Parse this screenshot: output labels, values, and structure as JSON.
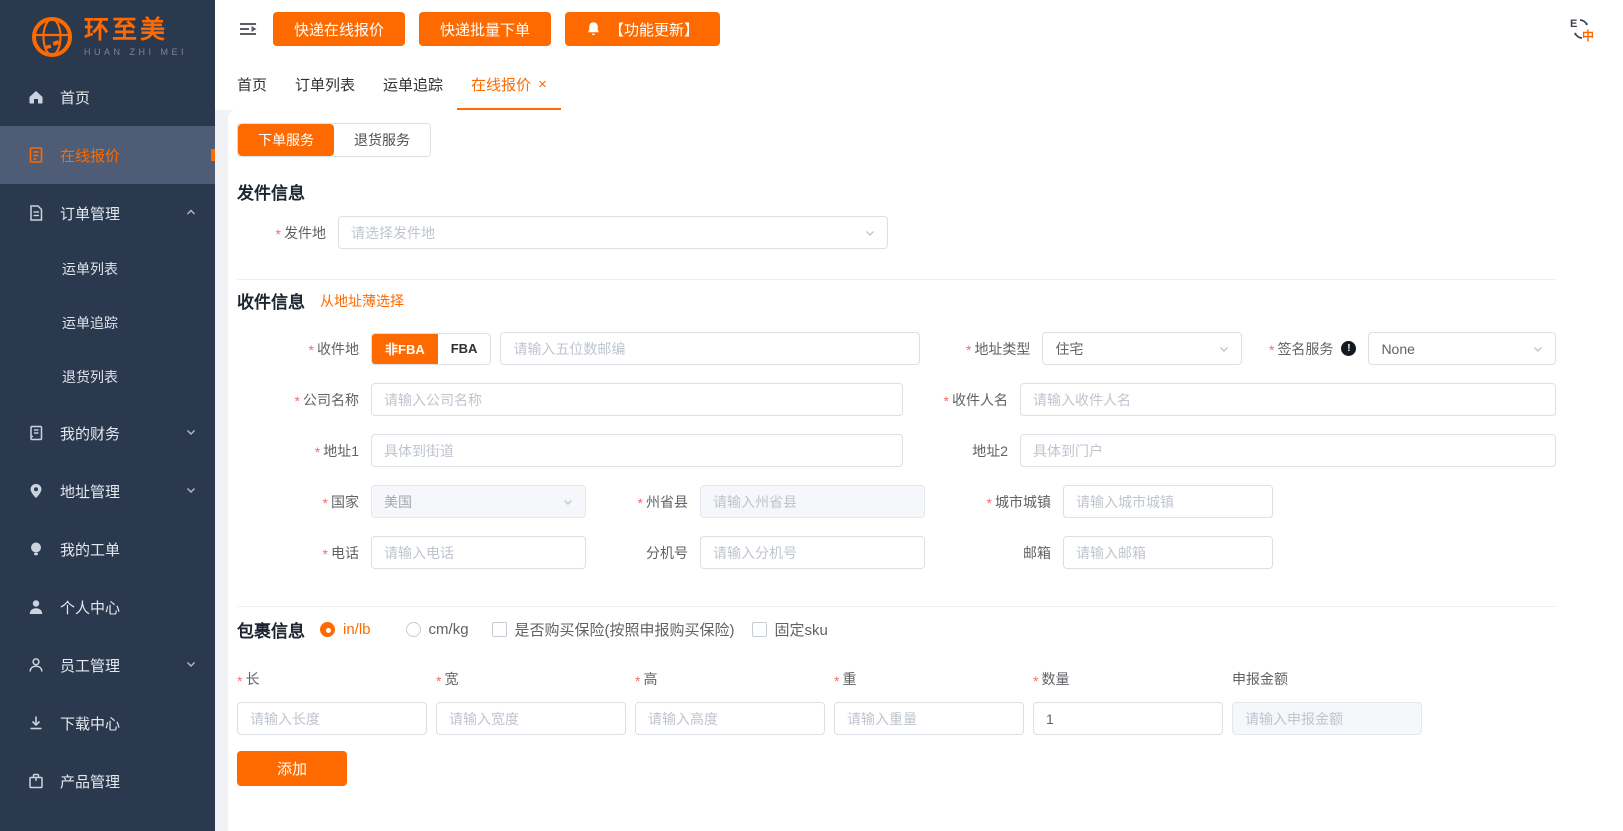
{
  "colors": {
    "accent": "#ff6a00",
    "sidebar_bg": "#2b394e",
    "sidebar_active_bg": "#4e5c75",
    "asterisk": "#f56c6c"
  },
  "misc": {
    "required_marker": "*"
  },
  "brand": {
    "name_cn": "环至美",
    "name_en": "HUAN ZHI MEI"
  },
  "sidebar": {
    "items": [
      {
        "label": "首页",
        "icon": "home-icon"
      },
      {
        "label": "在线报价",
        "icon": "quote-document-icon",
        "active": true
      },
      {
        "label": "订单管理",
        "icon": "order-document-icon",
        "expanded": true,
        "children": [
          {
            "label": "运单列表"
          },
          {
            "label": "运单追踪"
          },
          {
            "label": "退货列表"
          }
        ]
      },
      {
        "label": "我的财务",
        "icon": "finance-ledger-icon",
        "collapsed": true
      },
      {
        "label": "地址管理",
        "icon": "location-pin-icon",
        "collapsed": true
      },
      {
        "label": "我的工单",
        "icon": "work-order-bulb-icon"
      },
      {
        "label": "个人中心",
        "icon": "user-icon"
      },
      {
        "label": "员工管理",
        "icon": "staff-icon",
        "collapsed": true
      },
      {
        "label": "下载中心",
        "icon": "download-icon"
      },
      {
        "label": "产品管理",
        "icon": "product-box-icon"
      }
    ]
  },
  "topbar": {
    "buttons": [
      {
        "label": "快递在线报价"
      },
      {
        "label": "快递批量下单"
      },
      {
        "label": "【功能更新】",
        "icon": "bell-icon"
      }
    ],
    "lang_icon": {
      "from": "E",
      "to": "中"
    }
  },
  "tabs": {
    "items": [
      {
        "label": "首页"
      },
      {
        "label": "订单列表"
      },
      {
        "label": "运单追踪"
      },
      {
        "label": "在线报价",
        "active": true,
        "closable": true
      }
    ]
  },
  "service_tabs": {
    "items": [
      {
        "label": "下单服务",
        "active": true
      },
      {
        "label": "退货服务"
      }
    ]
  },
  "sender": {
    "title": "发件信息",
    "origin": {
      "label": "发件地",
      "required": true,
      "placeholder": "请选择发件地"
    }
  },
  "receiver": {
    "title": "收件信息",
    "address_book_link": "从地址薄选择",
    "fields": {
      "dest": {
        "label": "收件地",
        "required": true,
        "toggle": [
          {
            "label": "非FBA",
            "active": true
          },
          {
            "label": "FBA",
            "active": false
          }
        ],
        "zip_placeholder": "请输入五位数邮编"
      },
      "address_type": {
        "label": "地址类型",
        "required": true,
        "value": "住宅"
      },
      "signature": {
        "label": "签名服务",
        "required": true,
        "value": "None"
      },
      "company": {
        "label": "公司名称",
        "required": true,
        "placeholder": "请输入公司名称"
      },
      "recipient": {
        "label": "收件人名",
        "required": true,
        "placeholder": "请输入收件人名"
      },
      "address1": {
        "label": "地址1",
        "required": true,
        "placeholder": "具体到街道"
      },
      "address2": {
        "label": "地址2",
        "required": false,
        "placeholder": "具体到门户"
      },
      "country": {
        "label": "国家",
        "required": true,
        "value": "美国",
        "disabled": true
      },
      "state": {
        "label": "州省县",
        "required": true,
        "placeholder": "请输入州省县",
        "disabled": true
      },
      "city": {
        "label": "城市城镇",
        "required": true,
        "placeholder": "请输入城市城镇"
      },
      "phone": {
        "label": "电话",
        "required": true,
        "placeholder": "请输入电话"
      },
      "ext": {
        "label": "分机号",
        "required": false,
        "placeholder": "请输入分机号"
      },
      "email": {
        "label": "邮箱",
        "required": false,
        "placeholder": "请输入邮箱"
      }
    }
  },
  "package": {
    "title": "包裹信息",
    "units": [
      {
        "label": "in/lb",
        "selected": true
      },
      {
        "label": "cm/kg",
        "selected": false
      }
    ],
    "options": [
      {
        "label": "是否购买保险(按照申报购买保险)",
        "checked": false
      },
      {
        "label": "固定sku",
        "checked": false
      }
    ],
    "dims": [
      {
        "label": "长",
        "required": true,
        "placeholder": "请输入长度"
      },
      {
        "label": "宽",
        "required": true,
        "placeholder": "请输入宽度"
      },
      {
        "label": "高",
        "required": true,
        "placeholder": "请输入高度"
      },
      {
        "label": "重",
        "required": true,
        "placeholder": "请输入重量"
      },
      {
        "label": "数量",
        "required": true,
        "value": "1"
      },
      {
        "label": "申报金额",
        "required": false,
        "placeholder": "请输入申报金额",
        "disabled": true
      }
    ],
    "add_button": "添加"
  }
}
